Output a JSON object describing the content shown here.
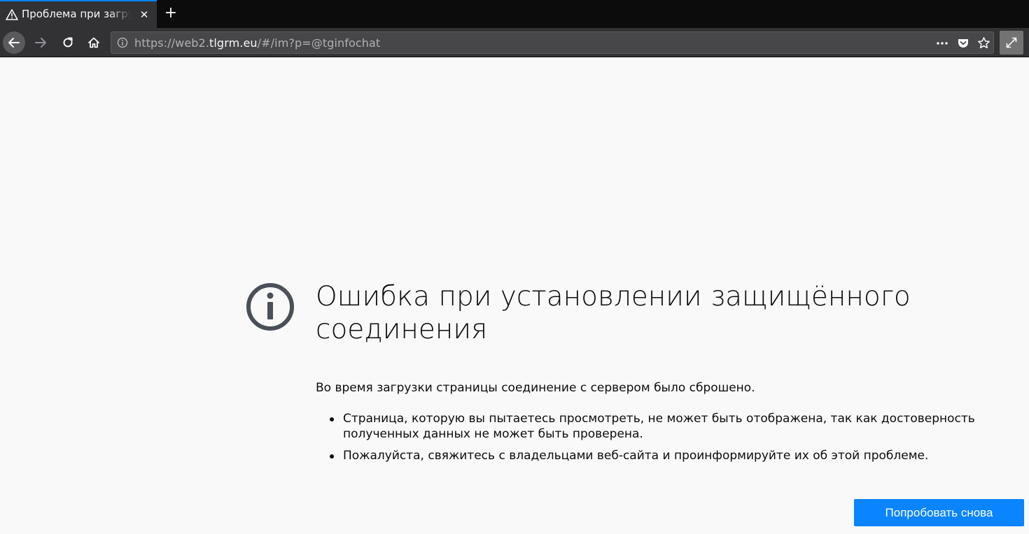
{
  "tab": {
    "title": "Проблема при загрузке страницы",
    "close_glyph": "✕",
    "new_tab_glyph": "+"
  },
  "urlbar": {
    "prefix": "https://web2.",
    "host": "tlgrm.eu",
    "path": "/#/im?p=@tginfochat"
  },
  "error": {
    "title": "Ошибка при установлении защищённого соединения",
    "description": "Во время загрузки страницы соединение с сервером было сброшено.",
    "items": [
      "Страница, которую вы пытаетесь просмотреть, не может быть отображена, так как достоверность полученных данных не может быть проверена.",
      "Пожалуйста, свяжитесь с владельцами веб-сайта и проинформируйте их об этой проблеме."
    ],
    "retry_label": "Попробовать снова"
  },
  "colors": {
    "accent": "#0a84ff",
    "tab_bg": "#323234",
    "page_bg": "#f9f9fa",
    "icon_gray": "#4a5058"
  },
  "icons": [
    "warning-icon",
    "close-icon",
    "plus-icon",
    "back-arrow-icon",
    "forward-arrow-icon",
    "reload-icon",
    "home-icon",
    "info-icon",
    "more-icon",
    "pocket-icon",
    "star-icon",
    "fullscreen-icon",
    "error-info-icon"
  ]
}
